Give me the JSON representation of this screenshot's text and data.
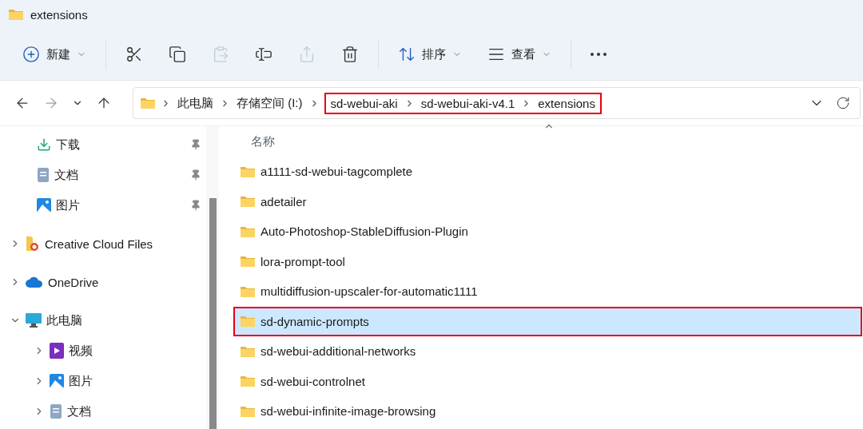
{
  "window": {
    "title": "extensions"
  },
  "toolbar": [
    {
      "kind": "menu",
      "label": "新建",
      "disabled": false
    },
    {
      "kind": "icon",
      "disabled": false
    },
    {
      "kind": "icon",
      "disabled": false
    },
    {
      "kind": "icon",
      "disabled": true
    },
    {
      "kind": "icon",
      "disabled": false
    },
    {
      "kind": "icon",
      "disabled": true
    },
    {
      "kind": "icon",
      "disabled": false
    },
    {
      "kind": "menu",
      "label": "排序",
      "disabled": false
    },
    {
      "kind": "menu",
      "label": "查看",
      "disabled": false
    },
    {
      "kind": "more",
      "disabled": false
    }
  ],
  "navigation": {
    "back_disabled": false,
    "forward_disabled": true
  },
  "breadcrumbs": [
    {
      "label": "此电脑",
      "outlined": false
    },
    {
      "label": "存储空间 (I:)",
      "outlined": false
    },
    {
      "label": "sd-webui-aki",
      "outlined": true
    },
    {
      "label": "sd-webui-aki-v4.1",
      "outlined": true
    },
    {
      "label": "extensions",
      "outlined": true
    }
  ],
  "sidebar": {
    "items": [
      {
        "label": "下载",
        "kind": "download",
        "pinned": true
      },
      {
        "label": "文档",
        "kind": "document",
        "pinned": true
      },
      {
        "label": "图片",
        "kind": "image",
        "pinned": true
      },
      {
        "label": "Creative Cloud Files",
        "kind": "cloudfolder",
        "expanded": false
      },
      {
        "label": "OneDrive",
        "kind": "onedrive",
        "expanded": false
      },
      {
        "label": "此电脑",
        "kind": "computer",
        "expanded": true,
        "children": [
          {
            "label": "视频",
            "kind": "video",
            "expanded": false
          },
          {
            "label": "图片",
            "kind": "image",
            "expanded": false
          },
          {
            "label": "文档",
            "kind": "document",
            "expanded": false
          }
        ]
      }
    ]
  },
  "file_list": {
    "columns": [
      "名称"
    ],
    "rows": [
      {
        "name": "a1111-sd-webui-tagcomplete",
        "selected": false,
        "outlined": false
      },
      {
        "name": "adetailer",
        "selected": false,
        "outlined": false
      },
      {
        "name": "Auto-Photoshop-StableDiffusion-Plugin",
        "selected": false,
        "outlined": false
      },
      {
        "name": "lora-prompt-tool",
        "selected": false,
        "outlined": false
      },
      {
        "name": "multidiffusion-upscaler-for-automatic1111",
        "selected": false,
        "outlined": false
      },
      {
        "name": "sd-dynamic-prompts",
        "selected": true,
        "outlined": true
      },
      {
        "name": "sd-webui-additional-networks",
        "selected": false,
        "outlined": false
      },
      {
        "name": "sd-webui-controlnet",
        "selected": false,
        "outlined": false
      },
      {
        "name": "sd-webui-infinite-image-browsing",
        "selected": false,
        "outlined": false
      }
    ]
  }
}
